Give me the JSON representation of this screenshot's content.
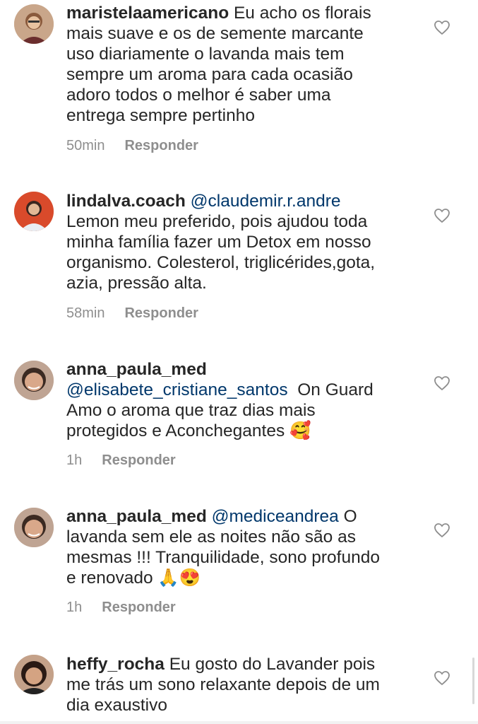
{
  "comments": [
    {
      "username": "maristelaamericano",
      "mention": "",
      "text_line1_rest": " Eu acho os florais",
      "lines": [
        "mais suave e os de semente marcante",
        "uso diariamente o lavanda mais tem",
        "sempre um aroma para cada ocasião",
        "adoro todos o melhor é saber uma",
        "entrega sempre pertinho"
      ],
      "time": "50min",
      "reply_label": "Responder",
      "avatar_icon": "avatar-photo"
    },
    {
      "username": "lindalva.coach",
      "mention": "@claudemir.r.andre",
      "lines": [
        "Lemon meu preferido, pois ajudou toda",
        "minha família fazer um Detox em nosso",
        "organismo. Colesterol, triglicérides,gota,",
        "azia, pressão alta."
      ],
      "time": "58min",
      "reply_label": "Responder",
      "avatar_icon": "avatar-photo"
    },
    {
      "username": "anna_paula_med",
      "mention": "@elisabete_cristiane_santos",
      "mention_after": "  On Guard",
      "lines": [
        "Amo o aroma que traz dias mais",
        "protegidos e Aconchegantes 🥰"
      ],
      "time": "1h",
      "reply_label": "Responder",
      "avatar_icon": "avatar-photo"
    },
    {
      "username": "anna_paula_med",
      "mention": "@mediceandrea",
      "mention_after": " O",
      "lines": [
        "lavanda sem ele as noites não são as",
        "mesmas !!! Tranquilidade, sono profundo",
        "e renovado 🙏😍"
      ],
      "time": "1h",
      "reply_label": "Responder",
      "avatar_icon": "avatar-photo"
    },
    {
      "username": "heffy_rocha",
      "text_line1_rest": " Eu gosto do Lavander pois",
      "lines": [
        "me trás um sono relaxante depois de um",
        "dia exaustivo"
      ],
      "avatar_icon": "avatar-photo"
    }
  ],
  "icons": {
    "like": "heart-outline-icon"
  },
  "colors": {
    "text": "#262626",
    "mention": "#00376b",
    "meta": "#8e8e8e"
  }
}
